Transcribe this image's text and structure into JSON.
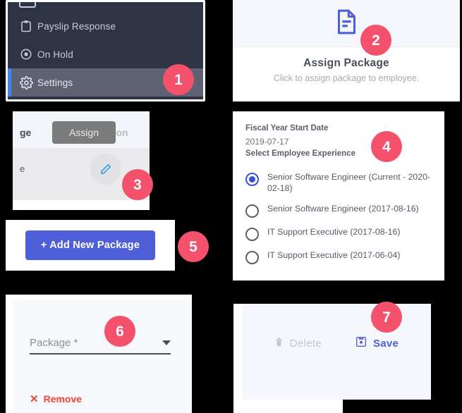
{
  "badges": [
    "1",
    "2",
    "3",
    "4",
    "5",
    "6",
    "7"
  ],
  "colors": {
    "badge": "#f4516c",
    "primary_blue": "#4f5fd8",
    "sidebar_bg": "#2f3445",
    "sidebar_active": "#5e6272",
    "sidebar_accent": "#3f86f5",
    "remove_red": "#f44336",
    "disabled_grey": "#c2c5cd"
  },
  "panel1_sidebar": {
    "items": [
      {
        "label": "Payslip Response",
        "icon": "clipboard-icon",
        "active": false
      },
      {
        "label": "On Hold",
        "icon": "on-hold-record-icon",
        "active": false
      },
      {
        "label": "Settings",
        "icon": "gear-icon",
        "active": true
      }
    ]
  },
  "panel2_assign_card": {
    "icon": "document-icon",
    "title": "Assign Package",
    "subtitle": "Click to assign package to employee."
  },
  "panel3_table": {
    "header_package": "ge",
    "header_action": "Action",
    "tooltip": "Assign",
    "row_cell": "e",
    "edit_icon": "pencil-icon"
  },
  "panel4_experience": {
    "fiscal_label": "Fiscal Year Start Date",
    "fiscal_value": "2019-07-17",
    "select_label": "Select Employee Experience",
    "options": [
      {
        "label": "Senior Software Engineer (Current - 2020-02-18)",
        "selected": true
      },
      {
        "label": "Senior Software Engineer (2017-08-16)",
        "selected": false
      },
      {
        "label": "IT Support Executive (2017-08-16)",
        "selected": false
      },
      {
        "label": "IT Support Executive (2017-06-04)",
        "selected": false
      }
    ]
  },
  "panel5_add": {
    "button_label": "+ Add New Package"
  },
  "panel6_select": {
    "placeholder": "Package *",
    "caret_icon": "chevron-down-icon",
    "remove_label": "Remove",
    "remove_x": "✕"
  },
  "panel7_actions": {
    "delete_label": "Delete",
    "delete_icon": "trash-icon",
    "save_label": "Save",
    "save_icon": "floppy-save-icon"
  }
}
